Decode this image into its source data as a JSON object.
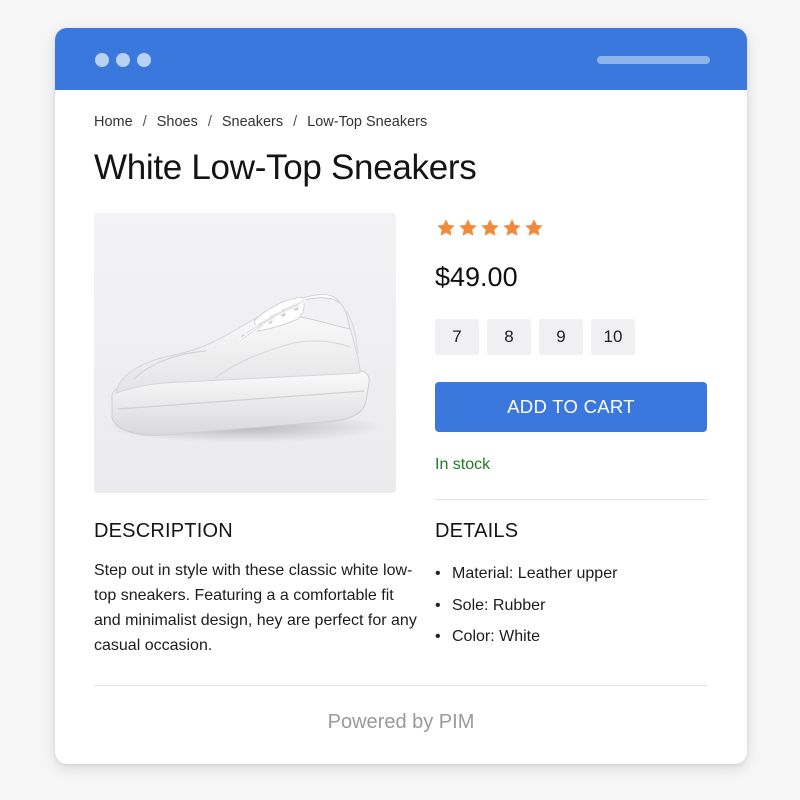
{
  "window": {
    "accent_color": "#3a78de",
    "controls": [
      "dot",
      "dot",
      "dot"
    ]
  },
  "breadcrumb": {
    "items": [
      "Home",
      "Shoes",
      "Sneakers",
      "Low-Top Sneakers"
    ],
    "separator": "/"
  },
  "product": {
    "title": "White Low-Top Sneakers",
    "image_icon": "sneaker-image",
    "rating": 5,
    "rating_max": 5,
    "star_color": "#f08a3c",
    "price": "$49.00",
    "sizes": [
      "7",
      "8",
      "9",
      "10"
    ],
    "add_to_cart_label": "ADD TO CART",
    "stock_status": "In stock",
    "stock_color": "#1f7a24"
  },
  "description": {
    "title": "DESCRIPTION",
    "text": "Step out in style with these classic white low-top sneakers. Featuring a a comfortable fit and minimalist design, hey are perfect for any casual occasion."
  },
  "details": {
    "title": "DETAILS",
    "items": [
      "Material: Leather upper",
      "Sole: Rubber",
      "Color: White"
    ]
  },
  "footer": {
    "text": "Powered by PIM"
  }
}
